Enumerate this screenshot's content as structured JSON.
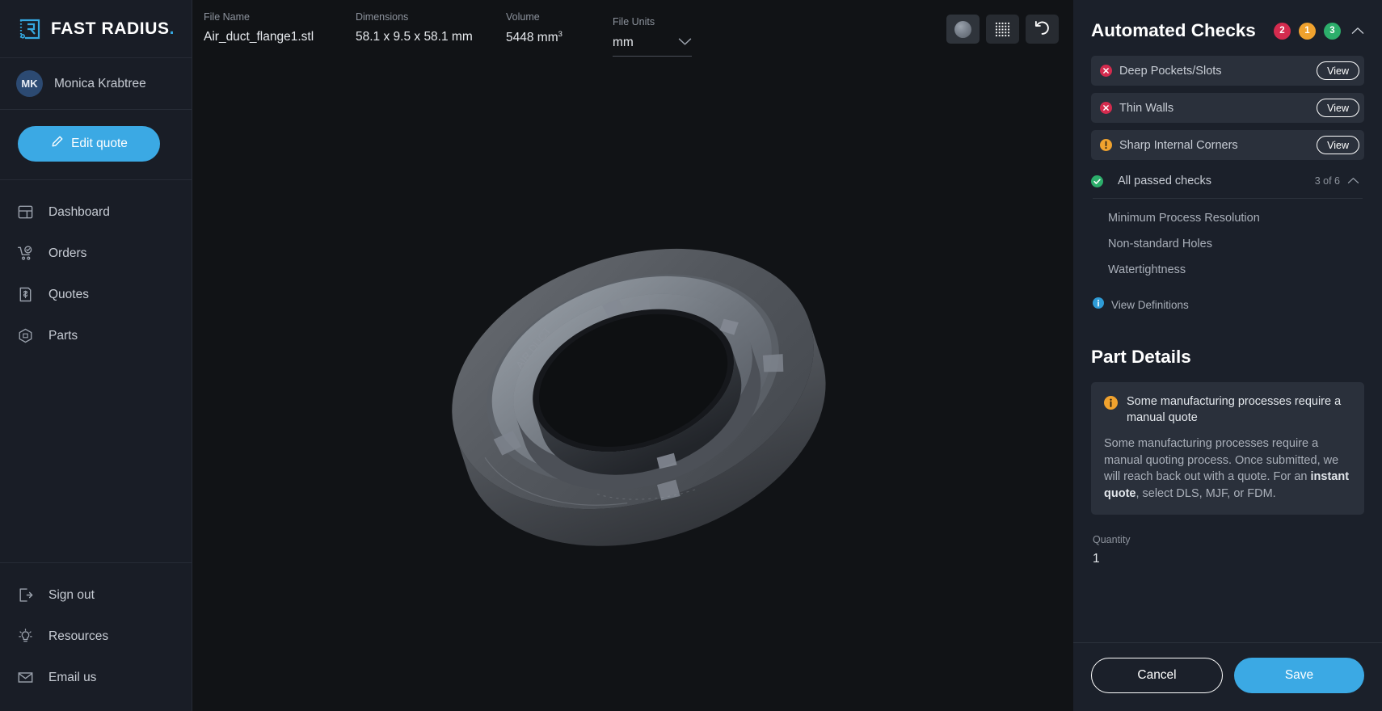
{
  "brand": {
    "name": "FAST RADIUS",
    "dot": ".",
    "logo_icon": "fast-radius-logo-icon",
    "accent": "#3BA9E4"
  },
  "user": {
    "initials": "MK",
    "name": "Monica Krabtree"
  },
  "actions": {
    "edit_quote": "Edit quote",
    "edit_icon": "pencil-icon"
  },
  "nav": {
    "primary": [
      {
        "label": "Dashboard",
        "icon": "dashboard-icon"
      },
      {
        "label": "Orders",
        "icon": "cart-check-icon"
      },
      {
        "label": "Quotes",
        "icon": "invoice-dollar-icon"
      },
      {
        "label": "Parts",
        "icon": "cube-icon"
      }
    ],
    "secondary": [
      {
        "label": "Sign out",
        "icon": "sign-out-icon"
      },
      {
        "label": "Resources",
        "icon": "lightbulb-icon"
      },
      {
        "label": "Email us",
        "icon": "envelope-icon"
      }
    ]
  },
  "file_info": {
    "file_name_label": "File Name",
    "file_name_value": "Air_duct_flange1.stl",
    "dimensions_label": "Dimensions",
    "dimensions_value": "58.1 x 9.5 x 58.1 mm",
    "volume_label": "Volume",
    "volume_value": "5448 mm",
    "volume_superscript": "3",
    "units_label": "File Units",
    "units_value": "mm",
    "units_caret": "chevron-down-icon"
  },
  "viewer_tools": [
    {
      "name": "shaded-view-button",
      "icon": "sphere-icon",
      "active": true
    },
    {
      "name": "grid-view-button",
      "icon": "dot-grid-icon",
      "active": false
    },
    {
      "name": "reset-view-button",
      "icon": "rotate-ccw-icon",
      "active": false
    }
  ],
  "model": {
    "name": "air-duct-flange-3d-model"
  },
  "checks": {
    "title": "Automated Checks",
    "badges": [
      {
        "count": "2",
        "severity": "error",
        "color": "#D42B4E"
      },
      {
        "count": "1",
        "severity": "warning",
        "color": "#F0A22E"
      },
      {
        "count": "3",
        "severity": "passed",
        "color": "#2CAE6B"
      }
    ],
    "collapse_icon": "chevron-up-icon",
    "items": [
      {
        "label": "Deep Pockets/Slots",
        "status": "error",
        "action": "View"
      },
      {
        "label": "Thin Walls",
        "status": "error",
        "action": "View"
      },
      {
        "label": "Sharp Internal Corners",
        "status": "warning",
        "action": "View"
      }
    ],
    "passed": {
      "label": "All passed checks",
      "count": "3 of 6",
      "icon": "check-circle-icon",
      "collapse_icon": "chevron-up-icon",
      "items": [
        "Minimum Process Resolution",
        "Non-standard Holes",
        "Watertightness"
      ]
    },
    "definitions": {
      "label": "View Definitions",
      "icon": "info-circle-icon"
    }
  },
  "part_details": {
    "title": "Part Details",
    "notice": {
      "icon": "info-circle-warning-icon",
      "title": "Some manufacturing processes require a manual quote",
      "body_before": "Some manufacturing processes require a manual quoting process. Once submitted, we will reach back out with a quote. For an ",
      "body_emphasis": "instant quote",
      "body_after": ", select DLS, MJF, or FDM."
    },
    "quantity_label": "Quantity",
    "quantity_value": "1"
  },
  "footer": {
    "cancel": "Cancel",
    "save": "Save"
  }
}
